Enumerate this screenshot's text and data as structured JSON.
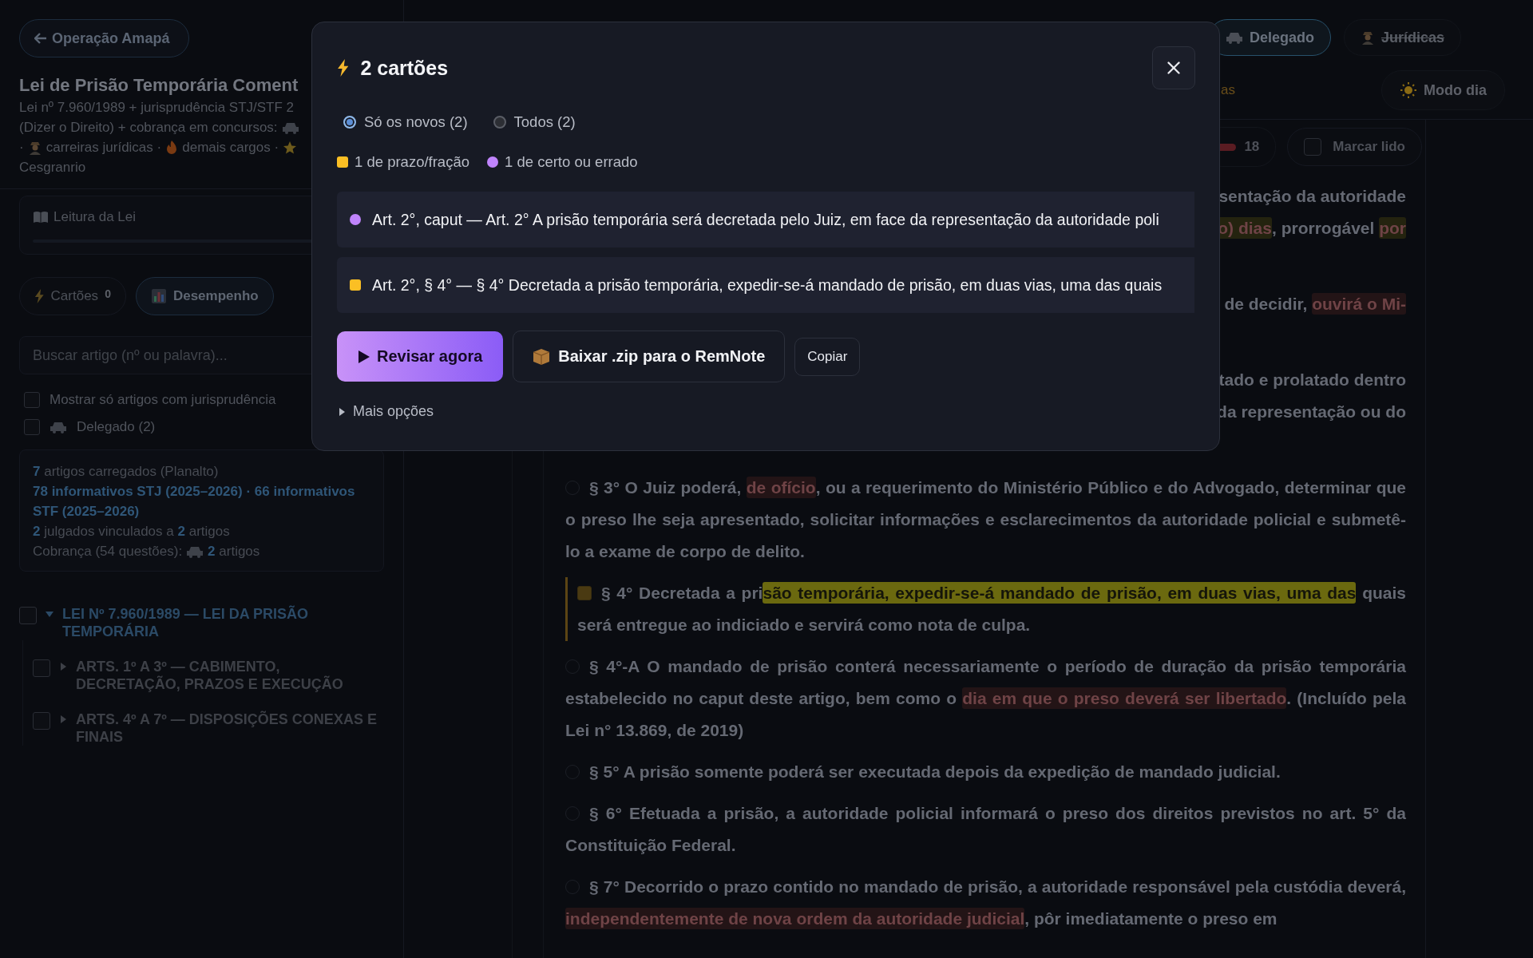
{
  "sidebar": {
    "back_button": "Operação Amapá",
    "title": "Lei de Prisão Temporária Coment",
    "subtitle": [
      [
        {
          "kind": "text",
          "text": "Lei nº 7.960/1989 + jurisprudência STJ/STF 2"
        }
      ],
      [
        {
          "kind": "text",
          "text": "(Dizer o Direito) + cobrança em concursos:"
        },
        {
          "kind": "icon"
        }
      ],
      [
        {
          "kind": "text",
          "text": "·"
        },
        {
          "kind": "icon"
        },
        {
          "kind": "text",
          "text": "carreiras jurídicas ·"
        },
        {
          "kind": "icon"
        },
        {
          "kind": "text",
          "text": "demais cargos ·"
        },
        {
          "kind": "icon"
        }
      ],
      [
        {
          "kind": "text",
          "text": "Cesgranrio"
        }
      ]
    ],
    "reading_card": {
      "label": "Leitura da Lei"
    },
    "buttons": [
      {
        "label": "Cartões",
        "count": "0",
        "selected": false
      },
      {
        "label": "Desempenho",
        "selected": true
      }
    ],
    "search": {
      "placeholder": "Buscar artigo (nº ou palavra)..."
    },
    "filters": [
      {
        "kind": "plain",
        "label": "Mostrar só artigos com jurisprudência",
        "checked": false
      },
      {
        "kind": "icon",
        "label": "Delegado (2)",
        "checked": false
      }
    ],
    "stats": [
      {
        "kind": "text",
        "text": "**7** artigos carregados (Planalto)"
      },
      {
        "kind": "strong",
        "text": "78 informativos STJ (2025–2026) · 66 informativos STF (2025–2026)"
      },
      {
        "kind": "text",
        "text": "**2** julgados vinculados a **2** artigos"
      },
      {
        "kind": "icon",
        "before": "Cobrança (54 questões):",
        "after": "**2** artigos"
      }
    ],
    "tree": [
      {
        "label": "LEI Nº 7.960/1989 — LEI DA PRISÃO TEMPORÁRIA",
        "checked": false,
        "expanded": true,
        "children": [
          {
            "label": "ARTS. 1º A 3º — CABIMENTO, DECRETAÇÃO, PRAZOS E EXECUÇÃO",
            "checked": false,
            "expanded": false
          },
          {
            "label": "ARTS. 4º A 7º — DISPOSIÇÕES CONEXAS E FINAIS",
            "checked": false,
            "expanded": false
          }
        ]
      }
    ]
  },
  "header": {
    "profiles": [
      {
        "label": "Delegado",
        "selected": true
      },
      {
        "label": "Jurídicas",
        "selected": false
      }
    ],
    "fragment": "as",
    "day_mode_button": "Modo dia"
  },
  "toolbar": {
    "meter_reading": "18",
    "mark_read": {
      "label": "Marcar lido",
      "checked": false
    }
  },
  "fragments": [
    [
      [
        {
          "text": "sentação da autoridade"
        }
      ],
      [
        {
          "text": "o) dias",
          "color": "#24230f"
        },
        {
          "text": ", prorrogável "
        },
        {
          "text": "por",
          "color": "#24230f"
        }
      ]
    ],
    [
      [
        {
          "text": "de decidir, "
        },
        {
          "text": "ouvirá o Mi-",
          "color": "#231416"
        }
      ]
    ],
    [
      [
        {
          "text": "tado e prolatado dentro"
        }
      ],
      [
        {
          "text": "da representação ou do"
        }
      ]
    ]
  ],
  "paragraphs": [
    {
      "selected": false,
      "parts": [
        {
          "text": "§ 3° O Juiz poderá, "
        },
        {
          "text": "de ofício",
          "color": "#231416"
        },
        {
          "text": ", ou a requerimento do Ministério Público e do Advogado, determinar que o preso lhe seja apresentado, solicitar informações e esclarecimentos da autoridade policial e submetê-lo a exame de corpo de delito."
        }
      ]
    },
    {
      "selected": true,
      "parts": [
        {
          "text": "§ 4° Decretada a pri"
        },
        {
          "text": "são temporária, expedir-se-á mandado de prisão, em duas vias, uma das",
          "color": "#6b690f"
        },
        {
          "text": " quais será entregue ao indiciado e servirá como nota de culpa."
        }
      ]
    },
    {
      "selected": false,
      "parts": [
        {
          "text": "§ 4°-A O mandado de prisão conterá necessariamente o período de duração da prisão temporária estabelecido no caput deste artigo, bem como o "
        },
        {
          "text": "dia em que o preso deverá ser libertado",
          "color": "#231416"
        },
        {
          "text": ". (Incluído pela Lei n° 13.869, de 2019)"
        }
      ]
    },
    {
      "selected": false,
      "parts": [
        {
          "text": "§ 5° A prisão somente poderá ser executada depois da expedição de mandado judicial."
        }
      ]
    },
    {
      "selected": false,
      "parts": [
        {
          "text": "§ 6° Efetuada a prisão, a autoridade policial informará o preso dos direitos previstos no art. 5° da Constituição Federal."
        }
      ]
    },
    {
      "selected": false,
      "parts": [
        {
          "text": "§ 7° Decorrido o prazo contido no mandado de prisão, a autoridade responsável pela custódia deverá, "
        },
        {
          "text": "independentemente de nova ordem da autoridade judicial",
          "color": "#231416"
        },
        {
          "text": ", pôr imediatamente o preso em"
        }
      ]
    }
  ],
  "modal": {
    "title": "2 cartões",
    "options": [
      {
        "label": "Só os novos (2)",
        "selected": true
      },
      {
        "label": "Todos (2)",
        "selected": false
      }
    ],
    "legend": [
      {
        "kind": "square",
        "color": "#fbbf24",
        "label": "1 de prazo/fração"
      },
      {
        "kind": "circle",
        "color": "#c084fc",
        "label": "1 de certo ou errado"
      }
    ],
    "cards": [
      {
        "kind": "circle",
        "color": "#c084fc",
        "text": "Art. 2°, caput — Art. 2° A prisão temporária será decretada pelo Juiz, em face da representação da autoridade poli"
      },
      {
        "kind": "square",
        "color": "#fbbf24",
        "text": "Art. 2°, § 4° — § 4° Decretada a prisão temporária, expedir-se-á mandado de prisão, em duas vias, uma das quais"
      }
    ],
    "primary_button": "Revisar agora",
    "download_button": "Baixar .zip para o RemNote",
    "copy_button": "Copiar",
    "more_options": {
      "label": "Mais opções",
      "expanded": false
    }
  }
}
